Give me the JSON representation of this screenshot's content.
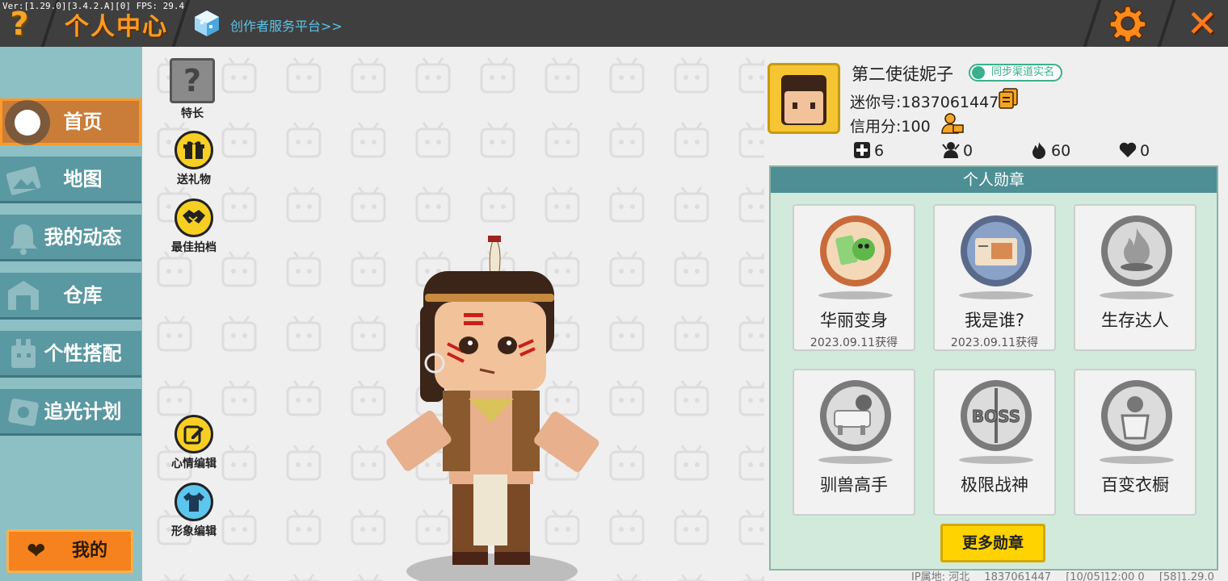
{
  "topbar": {
    "version": "Ver:[1.29.0][3.4.2.A][0] FPS: 29.4",
    "title": "个人中心",
    "creator_link": "创作者服务平台>>",
    "help_symbol": "?",
    "close_symbol": "✕"
  },
  "sidebar": {
    "items": [
      {
        "label": "首页",
        "icon": "home-icon"
      },
      {
        "label": "地图",
        "icon": "map-icon"
      },
      {
        "label": "我的动态",
        "icon": "bell-icon"
      },
      {
        "label": "仓库",
        "icon": "warehouse-icon"
      },
      {
        "label": "个性搭配",
        "icon": "outfit-icon"
      },
      {
        "label": "追光计划",
        "icon": "light-plan-icon"
      }
    ],
    "mine_label": "我的"
  },
  "actions": {
    "specialty": "特长",
    "specialty_symbol": "?",
    "send_gift": "送礼物",
    "best_partner": "最佳拍档",
    "mood_edit": "心情编辑",
    "image_edit": "形象编辑"
  },
  "profile": {
    "nickname": "第二使徒妮子",
    "verify_badge": "同步渠道实名",
    "mini_id": "迷你号:1837061447",
    "credit": "信用分:100",
    "stats": [
      {
        "icon": "plus-icon",
        "value": "6"
      },
      {
        "icon": "fans-icon",
        "value": "0"
      },
      {
        "icon": "fire-icon",
        "value": "60"
      },
      {
        "icon": "heart-icon",
        "value": "0"
      }
    ]
  },
  "medals": {
    "header": "个人勋章",
    "items": [
      {
        "name": "华丽变身",
        "date": "2023.09.11获得",
        "style": "gold"
      },
      {
        "name": "我是谁?",
        "date": "2023.09.11获得",
        "style": "blue"
      },
      {
        "name": "生存达人",
        "date": "",
        "style": "gray"
      },
      {
        "name": "驯兽高手",
        "date": "",
        "style": "gray"
      },
      {
        "name": "极限战神",
        "date": "",
        "style": "gray"
      },
      {
        "name": "百变衣橱",
        "date": "",
        "style": "gray"
      }
    ],
    "more_button": "更多勋章"
  },
  "footer": {
    "ip": "IP属地: 河北",
    "uid": "1837061447",
    "time": "[10/05]12:00 0",
    "build": "[58]1.29.0"
  },
  "colors": {
    "accent_orange": "#ff9a1f",
    "sidebar_teal": "#5a98a2",
    "medal_panel": "#d2eadb",
    "more_button": "#ffd300"
  }
}
